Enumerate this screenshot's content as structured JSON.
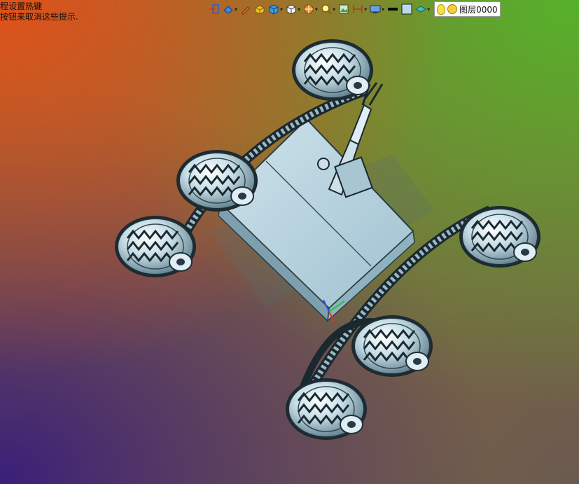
{
  "hint": {
    "line1": "程设置热键",
    "line2": "按钮来取消这些提示."
  },
  "toolbar": {
    "layer_name": "图层0000"
  }
}
